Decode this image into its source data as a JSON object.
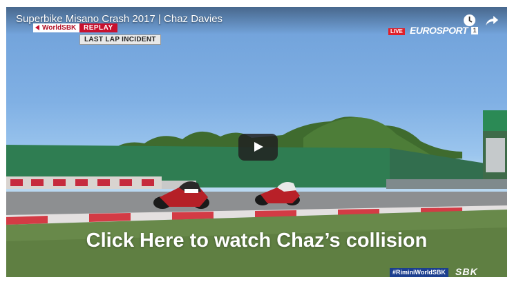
{
  "video": {
    "title": "Superbike Misano Crash 2017 | Chaz Davies",
    "caption": "Click Here to watch Chaz’s collision"
  },
  "overlay": {
    "series_tag": "WorldSBK",
    "replay_tag": "REPLAY",
    "incident_tag": "LAST LAP INCIDENT",
    "live_tag": "LIVE",
    "channel_name": "EUROSPORT",
    "channel_number": "1",
    "hashtag": "#RiminiWorldSBK",
    "brand": "SBK"
  },
  "controls": {
    "watch_later_icon": "clock-icon",
    "share_icon": "share-arrow-icon",
    "play_icon": "play-icon"
  },
  "colors": {
    "accent_red": "#c8102e",
    "player_button": "#212121",
    "hashtag_bg": "#1c3f8f"
  }
}
